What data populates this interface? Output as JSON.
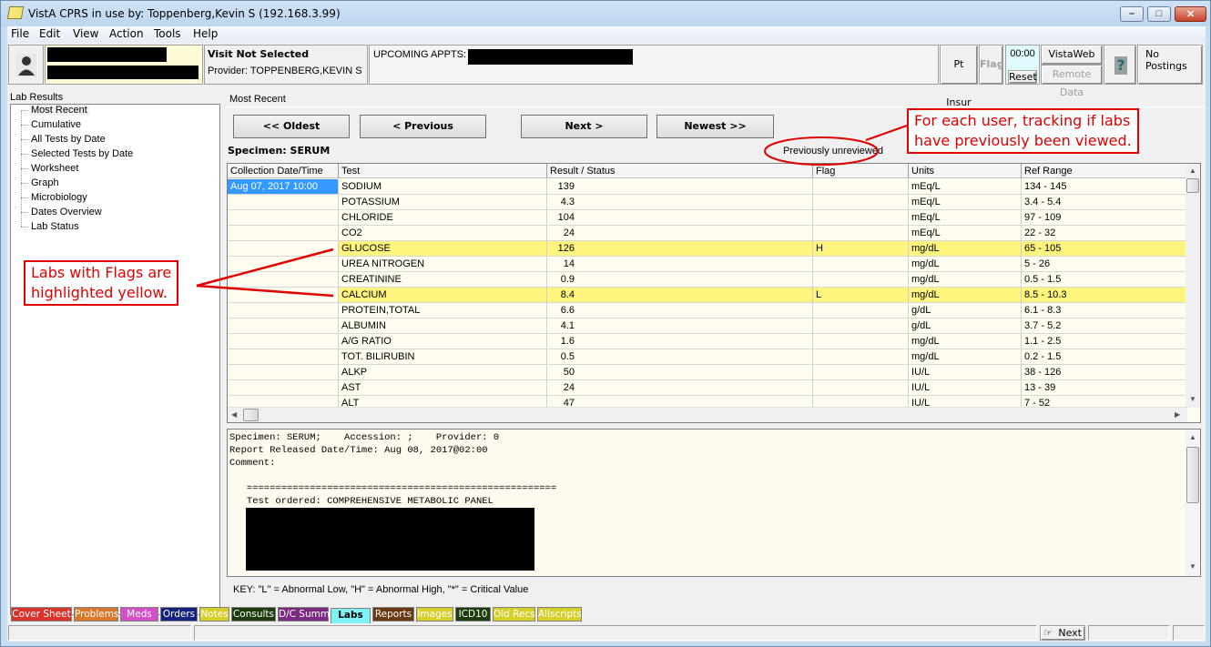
{
  "window": {
    "title": "VistA CPRS in use by: Toppenberg,Kevin S  (192.168.3.99)",
    "minimize_label": "–",
    "maximize_label": "□",
    "close_label": "✕"
  },
  "menu": [
    "File",
    "Edit",
    "View",
    "Action",
    "Tools",
    "Help"
  ],
  "header": {
    "visit_status": "Visit Not Selected",
    "provider": "Provider:  TOPPENBERG,KEVIN S",
    "upcoming_appts_label": "UPCOMING APPTS:",
    "pt_insur_label": "Pt Insur",
    "flag_label": "Flag",
    "timer": "00:00",
    "reset_label": "Reset",
    "vistaweb_label": "VistaWeb",
    "remote_data_label": "Remote Data",
    "help_label": "?",
    "postings_label": "No Postings"
  },
  "left_panel": {
    "title": "Lab Results",
    "items": [
      {
        "label": "Most Recent",
        "selected": true
      },
      {
        "label": "Cumulative"
      },
      {
        "label": "All Tests by Date"
      },
      {
        "label": "Selected Tests by Date"
      },
      {
        "label": "Worksheet"
      },
      {
        "label": "Graph"
      },
      {
        "label": "Microbiology"
      },
      {
        "label": "Dates Overview"
      },
      {
        "label": "Lab Status"
      }
    ]
  },
  "main": {
    "view_title": "Most Recent",
    "nav_buttons": {
      "oldest": "<< Oldest",
      "previous": "< Previous",
      "next": "Next >",
      "newest": "Newest >>"
    },
    "specimen": "Specimen: SERUM",
    "review_status": "Previously unreviewed",
    "columns": [
      "Collection Date/Time",
      "Test",
      "Result / Status",
      "Flag",
      "Units",
      "Ref Range"
    ],
    "collection_datetime": "Aug 07, 2017 10:00",
    "rows": [
      {
        "test": "SODIUM",
        "result": "139",
        "flag": "",
        "units": "mEq/L",
        "range": "134 - 145"
      },
      {
        "test": "POTASSIUM",
        "result": "4.3",
        "flag": "",
        "units": "mEq/L",
        "range": "3.4 - 5.4"
      },
      {
        "test": "CHLORIDE",
        "result": "104",
        "flag": "",
        "units": "mEq/L",
        "range": "97 - 109"
      },
      {
        "test": "CO2",
        "result": "24",
        "flag": "",
        "units": "mEq/L",
        "range": "22 - 32"
      },
      {
        "test": "GLUCOSE",
        "result": "126",
        "flag": "H",
        "units": "mg/dL",
        "range": "65 - 105"
      },
      {
        "test": "UREA NITROGEN",
        "result": "14",
        "flag": "",
        "units": "mg/dL",
        "range": "5 - 26"
      },
      {
        "test": "CREATININE",
        "result": "0.9",
        "flag": "",
        "units": "mg/dL",
        "range": "0.5 - 1.5"
      },
      {
        "test": "CALCIUM",
        "result": "8.4",
        "flag": "L",
        "units": "mg/dL",
        "range": "8.5 - 10.3"
      },
      {
        "test": "PROTEIN,TOTAL",
        "result": "6.6",
        "flag": "",
        "units": "g/dL",
        "range": "6.1 - 8.3"
      },
      {
        "test": "ALBUMIN",
        "result": "4.1",
        "flag": "",
        "units": "g/dL",
        "range": "3.7 - 5.2"
      },
      {
        "test": "A/G RATIO",
        "result": "1.6",
        "flag": "",
        "units": "mg/dL",
        "range": "1.1 - 2.5"
      },
      {
        "test": "TOT. BILIRUBIN",
        "result": "0.5",
        "flag": "",
        "units": "mg/dL",
        "range": "0.2 - 1.5"
      },
      {
        "test": "ALKP",
        "result": "50",
        "flag": "",
        "units": "IU/L",
        "range": "38 - 126"
      },
      {
        "test": "AST",
        "result": "24",
        "flag": "",
        "units": "IU/L",
        "range": "13 - 39"
      },
      {
        "test": "ALT",
        "result": "47",
        "flag": "",
        "units": "IU/L",
        "range": "7 - 52"
      }
    ],
    "highlight_color": "#fff47e",
    "report_lines": [
      "Specimen: SERUM;    Accession: ;    Provider: 0",
      "Report Released Date/Time: Aug 08, 2017@02:00",
      "Comment:",
      "",
      "   ======================================================",
      "   Test ordered: COMPREHENSIVE METABOLIC PANEL"
    ],
    "key_text": "KEY: \"L\" = Abnormal Low, \"H\" = Abnormal High, \"*\" = Critical Value"
  },
  "tabs": [
    {
      "label": "Cover Sheet",
      "bg": "#d9342b",
      "fg": "#ffffff"
    },
    {
      "label": "Problems",
      "bg": "#d8782c",
      "fg": "#ffffff"
    },
    {
      "label": "Meds",
      "bg": "#d24fc8",
      "fg": "#ffffff"
    },
    {
      "label": "Orders",
      "bg": "#15237e",
      "fg": "#ffffff"
    },
    {
      "label": "Notes",
      "bg": "#d6cf2a",
      "fg": "#ffffff"
    },
    {
      "label": "Consults",
      "bg": "#1d3d0c",
      "fg": "#ffffff"
    },
    {
      "label": "D/C Summ",
      "bg": "#7a2a80",
      "fg": "#ffffff"
    },
    {
      "label": "Labs",
      "bg": "#7ff2f6",
      "fg": "#000000",
      "active": true
    },
    {
      "label": "Reports",
      "bg": "#6a3a14",
      "fg": "#ffffff"
    },
    {
      "label": "Images",
      "bg": "#d6cf2a",
      "fg": "#ffffff"
    },
    {
      "label": "ICD10",
      "bg": "#1d3d0c",
      "fg": "#ffffff"
    },
    {
      "label": "Old Recs",
      "bg": "#d6cf2a",
      "fg": "#ffffff"
    },
    {
      "label": "Allscripts",
      "bg": "#d6cf2a",
      "fg": "#ffffff"
    }
  ],
  "statusbar": {
    "next_label": "Next"
  },
  "annotations": {
    "review_callout": [
      "For each user, tracking if labs",
      "have previously been viewed."
    ],
    "flag_callout": [
      "Labs with Flags are",
      "highlighted yellow."
    ],
    "color": "#e00000"
  }
}
